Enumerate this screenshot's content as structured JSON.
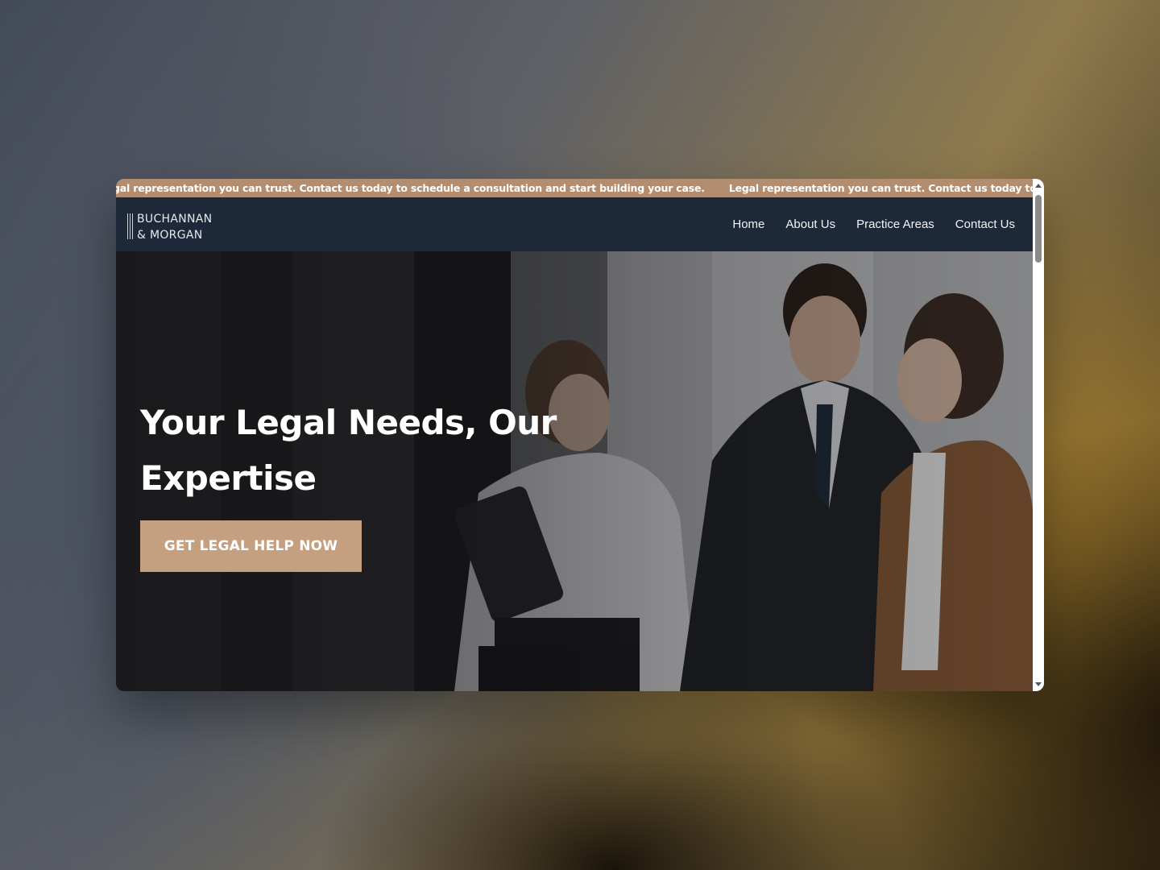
{
  "ticker": {
    "message_1": "Legal representation you can trust. Contact us today to schedule a consultation and start building your case.",
    "message_2": "Legal representation you can trust. Contact us today to schedule a consultation and start building your case."
  },
  "brand": {
    "line1": "BUCHANNAN",
    "line2": "& MORGAN"
  },
  "nav": {
    "items": [
      {
        "label": "Home"
      },
      {
        "label": "About Us"
      },
      {
        "label": "Practice Areas"
      },
      {
        "label": "Contact Us"
      }
    ]
  },
  "hero": {
    "title": "Your Legal Needs, Our Expertise",
    "cta_label": "GET LEGAL HELP NOW"
  },
  "colors": {
    "ticker_bg": "#b38d6f",
    "navbar_bg": "#1d2939",
    "cta_bg": "#c49f80"
  }
}
